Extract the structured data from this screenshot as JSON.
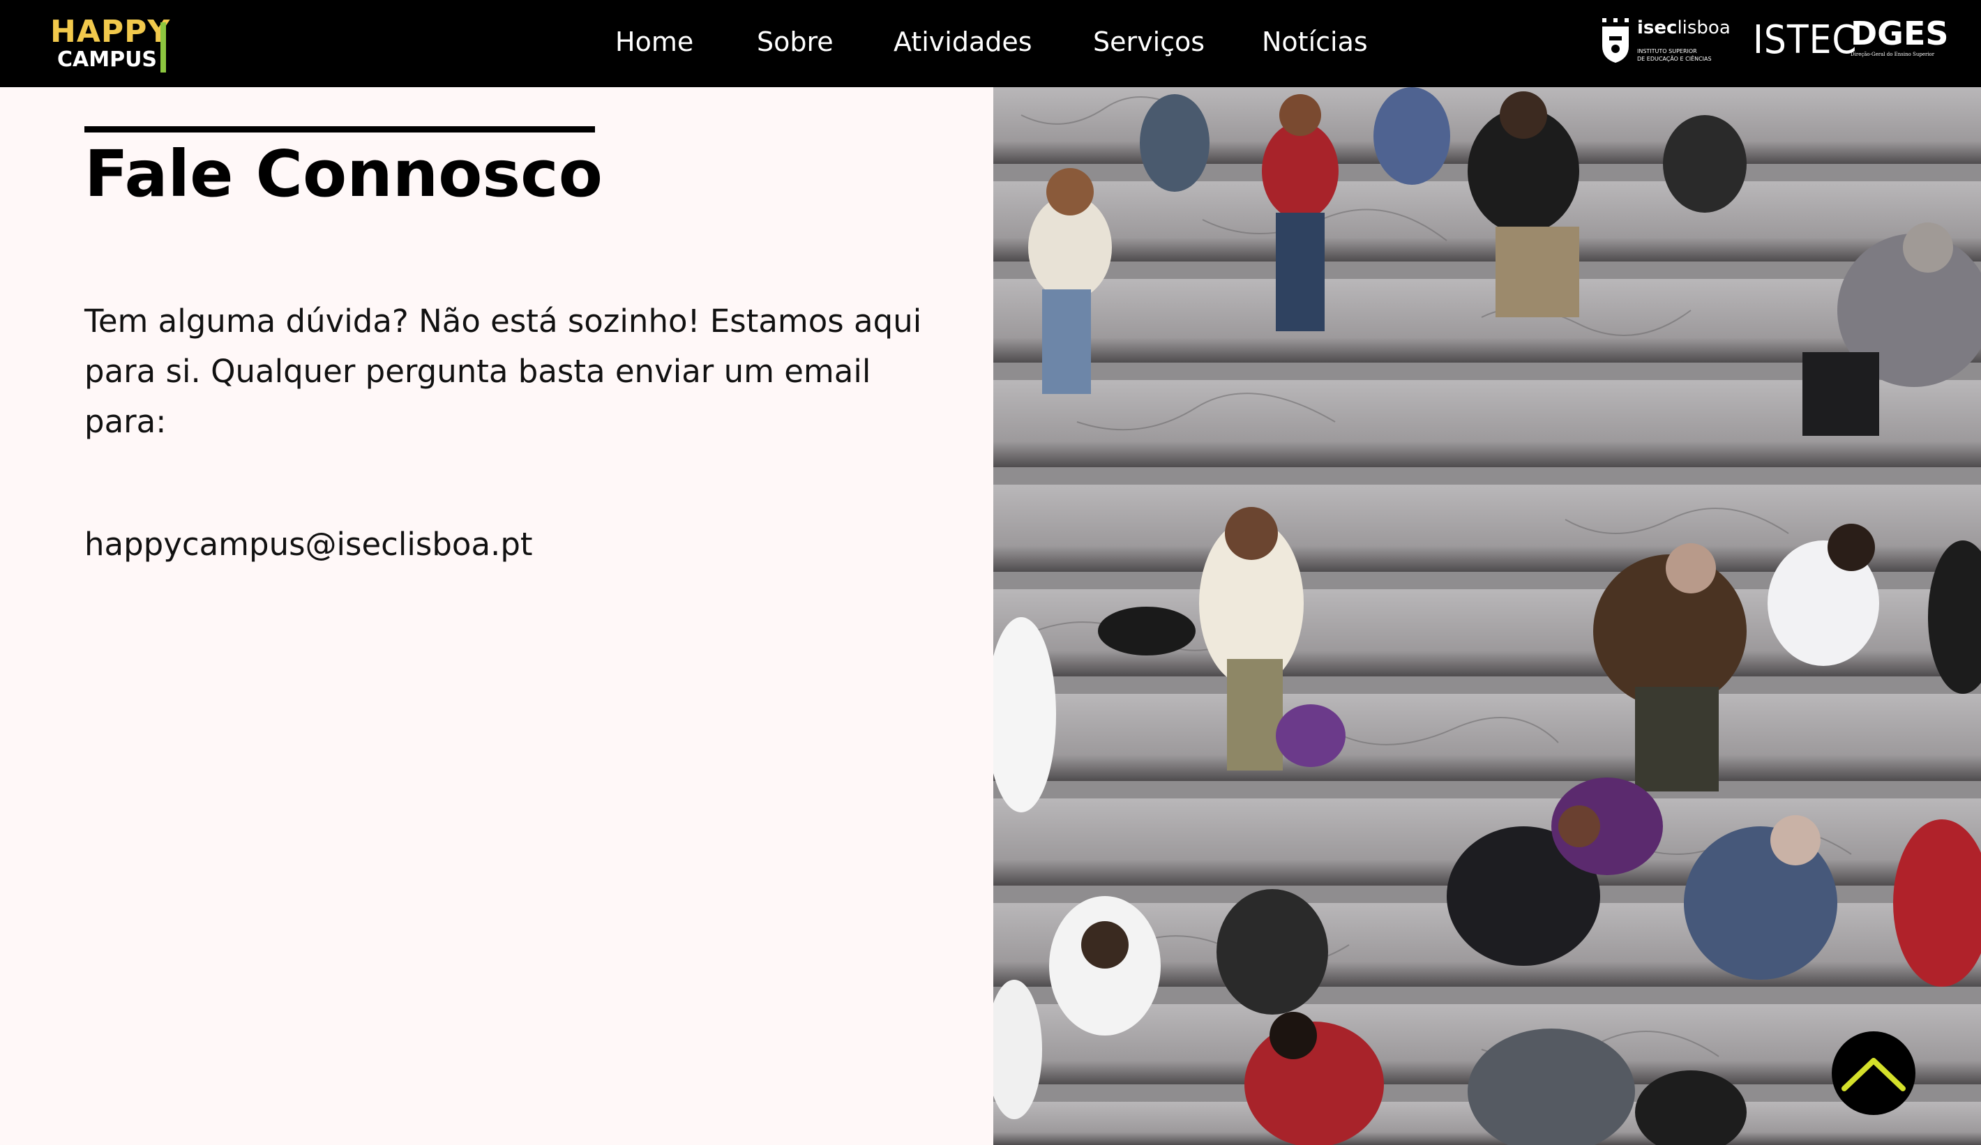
{
  "brand": {
    "logo_happy": "HAPPY",
    "logo_campus": "CAMPUS"
  },
  "nav": {
    "items": [
      "Home",
      "Sobre",
      "Atividades",
      "Serviços",
      "Notícias"
    ]
  },
  "partners": {
    "iseclisboa_bold": "isec",
    "iseclisboa_light": "lisboa",
    "iseclisboa_sub": "INSTITUTO SUPERIOR\nDE EDUCAÇÃO E CIÊNCIAS",
    "istec": "ISTEC",
    "dges": "DGES",
    "dges_sub": "Direção-Geral do Ensino Superior"
  },
  "contact": {
    "title": "Fale Connosco",
    "intro": "Tem alguma dúvida? Não está sozinho! Estamos aqui para si. Qualquer pergunta basta enviar um email para:",
    "email": "happycampus@iseclisboa.pt"
  },
  "colors": {
    "nav_bg": "#000000",
    "page_bg": "#fff8f8",
    "logo_yellow": "#f2c94c",
    "logo_green": "#8cc63f",
    "scroll_arrow": "#d4e02a"
  },
  "icons": {
    "scroll_top": "chevron-up-icon",
    "photo": "crowd-on-stairs-image"
  }
}
